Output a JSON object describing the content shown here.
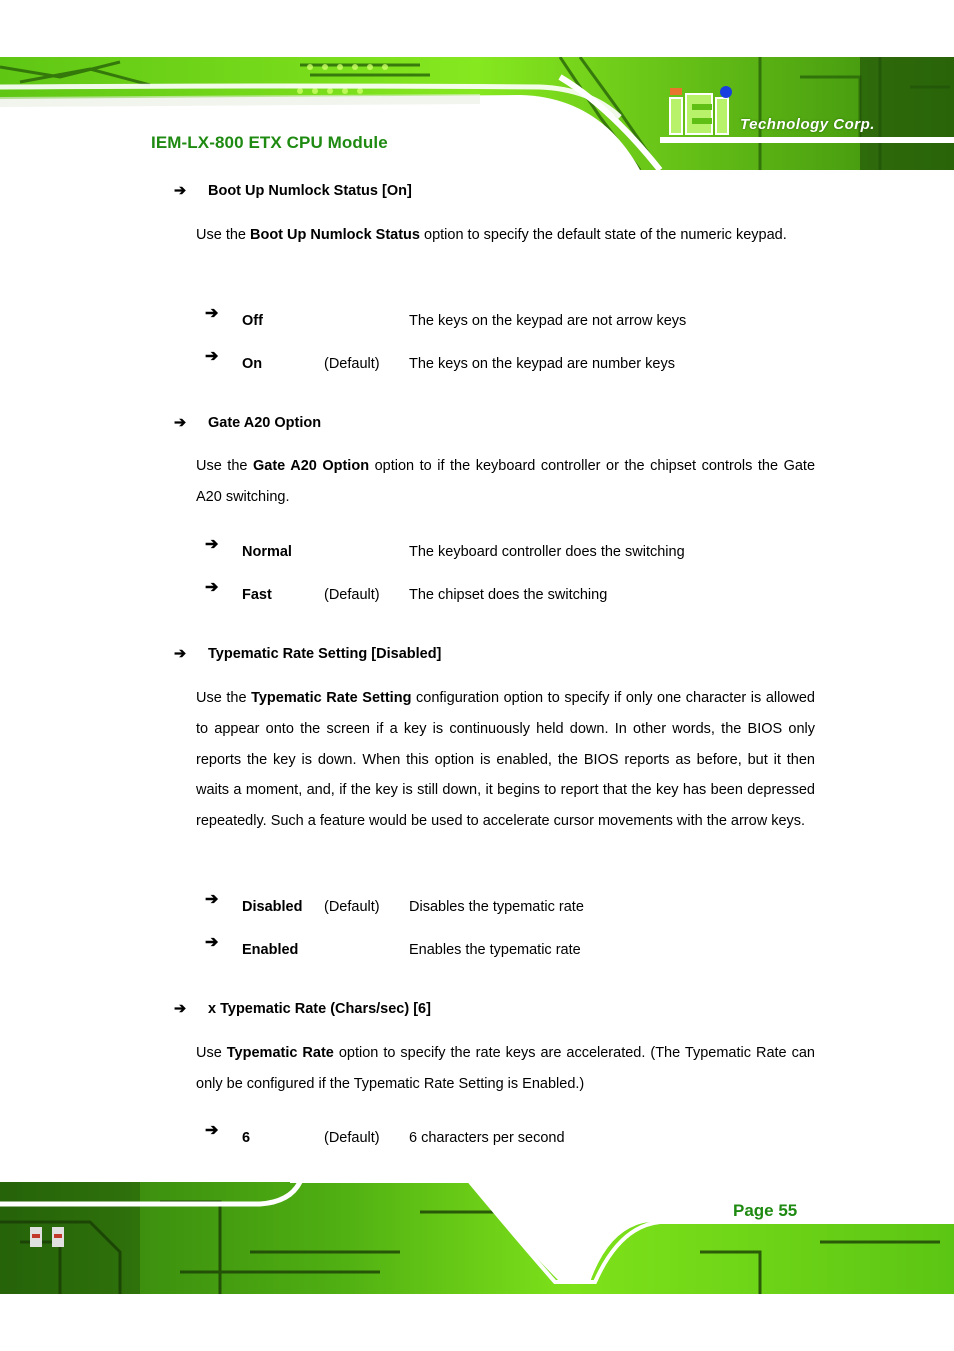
{
  "header": {
    "doc_title": "IEM-LX-800 ETX CPU Module",
    "logo_mark": "iEi",
    "logo_text": "Technology Corp.",
    "colors": {
      "title_green": "#1f8a12",
      "pcb_green": "#7ee21a",
      "pcb_dark": "#1e4a08"
    }
  },
  "sections": [
    {
      "heading": "Boot Up Numlock Status [On]",
      "paragraph": {
        "pre": "Use the ",
        "bold": "Boot Up Numlock Status",
        "post": " option to specify the default state of the numeric keypad."
      },
      "options": [
        {
          "name": "Off",
          "default": "",
          "desc": "The keys on the keypad are not arrow keys"
        },
        {
          "name": "On",
          "default": "(Default)",
          "desc": "The keys on the keypad are number keys"
        }
      ]
    },
    {
      "heading": "Gate A20 Option",
      "paragraph": {
        "pre": "Use the ",
        "bold": "Gate A20 Option",
        "post": " option to if the keyboard controller or the chipset controls the Gate A20 switching."
      },
      "options": [
        {
          "name": "Normal",
          "default": "",
          "desc": "The keyboard controller does the switching"
        },
        {
          "name": "Fast",
          "default": "(Default)",
          "desc": "The chipset does the switching"
        }
      ]
    },
    {
      "heading": "Typematic Rate Setting [Disabled]",
      "paragraph": {
        "pre": "Use the ",
        "bold": "Typematic Rate Setting",
        "post": " configuration option to specify if only one character is allowed to appear onto the screen if a key is continuously held down. In other words, the BIOS only reports the key is down. When this option is enabled, the BIOS reports as before, but it then waits a moment, and, if the key is still down, it begins to report that the key has been depressed repeatedly. Such a feature would be used to accelerate cursor movements with the arrow keys."
      },
      "options": [
        {
          "name": "Disabled",
          "default": "(Default)",
          "desc": "Disables the typematic rate"
        },
        {
          "name": "Enabled",
          "default": "",
          "desc": "Enables the typematic rate"
        }
      ]
    },
    {
      "heading": "x Typematic Rate (Chars/sec) [6]",
      "paragraph": {
        "pre": "Use ",
        "bold": "Typematic Rate",
        "post": " option to specify the rate keys are accelerated. (The Typematic Rate can only be configured if the Typematic Rate Setting is Enabled.)"
      },
      "options": [
        {
          "name": "6",
          "default": "(Default)",
          "desc": "6 characters per second"
        }
      ]
    }
  ],
  "arrow_glyph": "➔",
  "footer": {
    "page_label": "Page 55"
  }
}
